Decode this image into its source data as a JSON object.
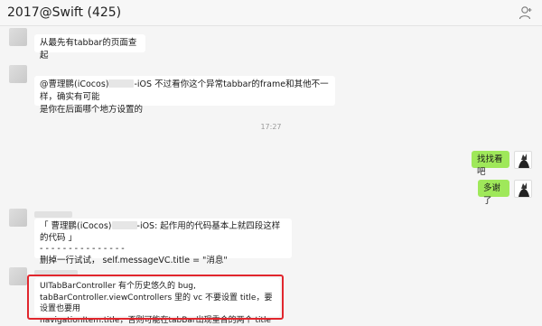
{
  "header": {
    "title": "2017@Swift  (425)",
    "user_icon": "add-contact-icon"
  },
  "messages": [
    {
      "id": "m1",
      "side": "left",
      "text": "从最先有tabbar的页面查起"
    },
    {
      "id": "m2",
      "side": "left",
      "line1_pre": "@曹理鹏(iCocos)",
      "line1_post": "-iOS 不过看你这个异常tabbar的frame和其他不一样，确实有可能",
      "line2": "是你在后面哪个地方设置的"
    },
    {
      "id": "time",
      "text": "17:27"
    },
    {
      "id": "m3",
      "side": "right",
      "text": "找找看吧"
    },
    {
      "id": "m4",
      "side": "right",
      "text": "多谢了"
    },
    {
      "id": "m5",
      "side": "left",
      "line1_pre": "「 曹理鹏(iCocos)",
      "line1_post": "-iOS: 起作用的代码基本上就四段这样的代码 」",
      "line2": "- - - - - - - - - - - - - - -",
      "line3": "删掉一行试试， self.messageVC.title = \"消息\""
    },
    {
      "id": "m6",
      "side": "left",
      "line1": "UITabBarController 有个历史悠久的 bug,",
      "line2": "tabBarController.viewControllers 里的 vc 不要设置 title，要设置也要用",
      "line3": "navigationItem.title，否则可能在tabBar出现重合的两个 title"
    }
  ],
  "colors": {
    "bubble_green": "#9fe85a",
    "highlight_red": "#e1262d"
  }
}
